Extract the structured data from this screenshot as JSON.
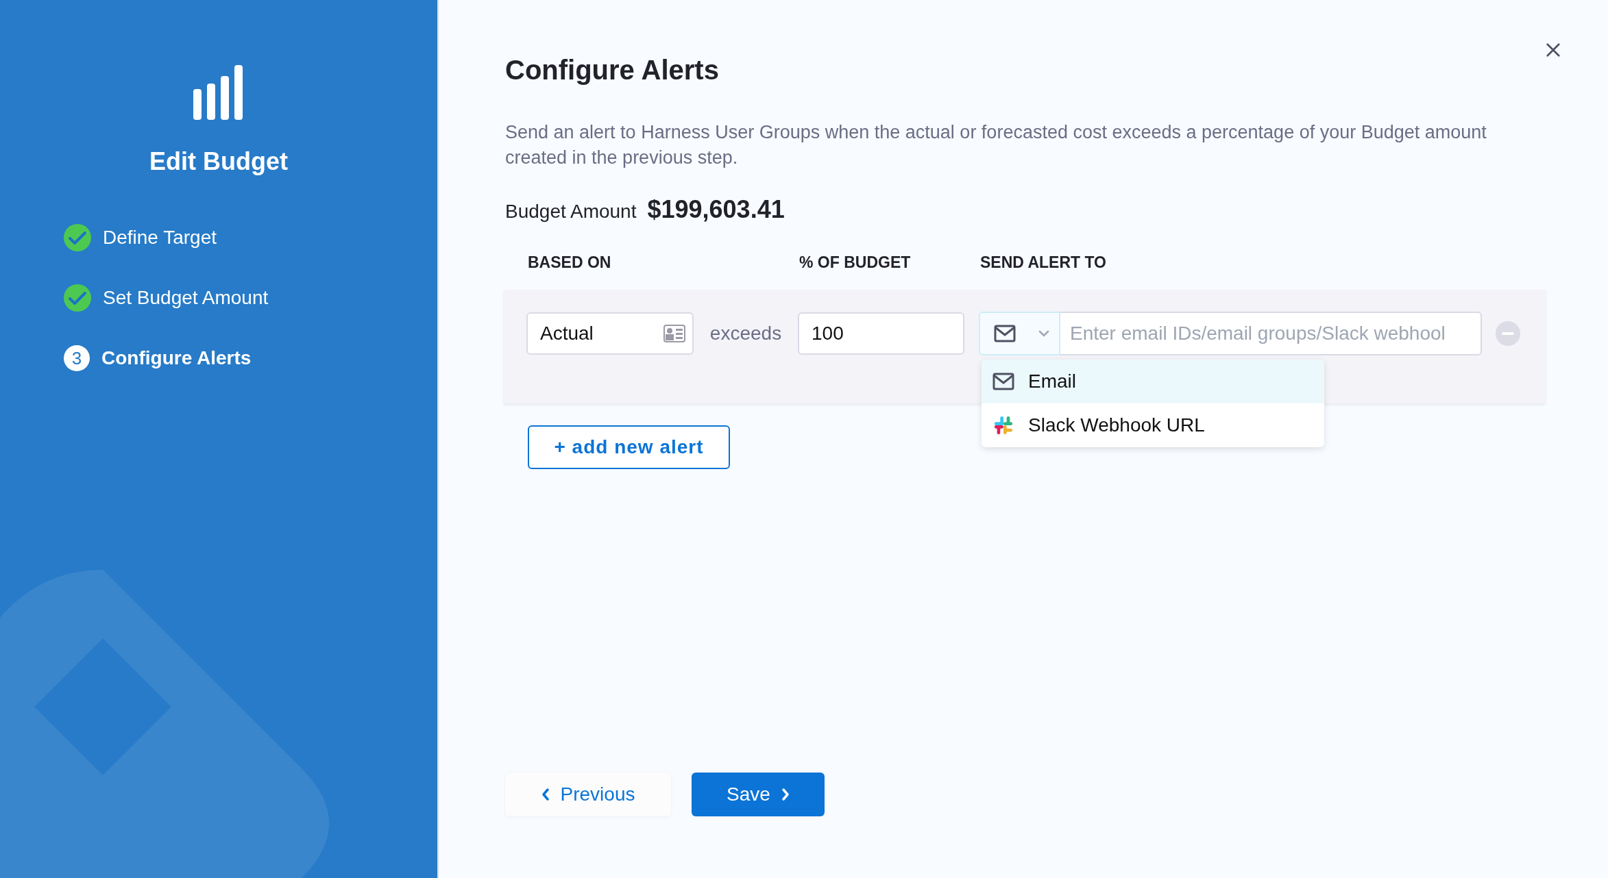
{
  "sidebar": {
    "title": "Edit Budget",
    "steps": [
      {
        "label": "Define Target",
        "kind": "done",
        "selected": false
      },
      {
        "label": "Set Budget Amount",
        "kind": "done",
        "selected": false
      },
      {
        "label": "Configure Alerts",
        "kind": "current",
        "number": "3",
        "selected": true
      }
    ]
  },
  "main": {
    "title": "Configure Alerts",
    "description": "Send an alert to Harness User Groups when the actual or forecasted cost exceeds a percentage of your Budget amount created in the previous step.",
    "budget_amount": {
      "label": "Budget Amount",
      "value": "$199,603.41"
    },
    "columns": [
      "BASED ON",
      "% OF BUDGET",
      "SEND ALERT TO"
    ],
    "alerts": [
      {
        "based_on": "Actual",
        "connector": "exceeds",
        "percentage": "100",
        "recipients_placeholder": "Enter email IDs/email groups/Slack webhool"
      }
    ],
    "channel_menu": [
      {
        "label": "Email",
        "kind": "email",
        "selected": true
      },
      {
        "label": "Slack Webhook URL",
        "kind": "slack",
        "selected": false
      }
    ],
    "add_button": "+ add new alert",
    "previous_button": "Previous",
    "save_button": "Save"
  }
}
